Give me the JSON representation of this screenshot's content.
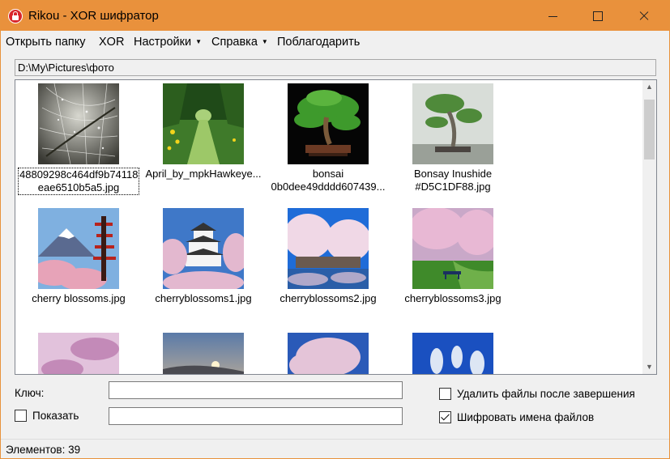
{
  "window": {
    "title": "Rikou - XOR шифратор",
    "accent": "#e9913c"
  },
  "menu": {
    "open_folder": "Открыть папку",
    "xor": "XOR",
    "settings": "Настройки",
    "help": "Справка",
    "thank": "Поблагодарить"
  },
  "path": "D:\\My\\Pictures\\фото",
  "files": [
    {
      "line1": "48809298c464df9b74118",
      "line2": "eae6510b5a5.jpg",
      "icon": "dewy-spiderweb-thumbnail"
    },
    {
      "line1": "April_by_mpkHawkeye...",
      "line2": "",
      "icon": "meadow-path-thumbnail"
    },
    {
      "line1": "bonsai",
      "line2": "0b0dee49dddd607439...",
      "icon": "bonsai-tree-thumbnail"
    },
    {
      "line1": "Bonsay Inushide",
      "line2": "#D5C1DF88.jpg",
      "icon": "bonsai-tree-thumbnail"
    },
    {
      "line1": "cherry blossoms.jpg",
      "line2": "",
      "icon": "pagoda-mount-fuji-thumbnail"
    },
    {
      "line1": "cherryblossoms1.jpg",
      "line2": "",
      "icon": "castle-blossoms-thumbnail"
    },
    {
      "line1": "cherryblossoms2.jpg",
      "line2": "",
      "icon": "blossom-river-thumbnail"
    },
    {
      "line1": "cherryblossoms3.jpg",
      "line2": "",
      "icon": "blossom-park-bench-thumbnail"
    }
  ],
  "key_label": "Ключ:",
  "key_value": "",
  "show_label": "Показать",
  "show_checked": false,
  "delete_label": "Удалить файлы после завершения",
  "delete_checked": false,
  "encrypt_names_label": "Шифровать имена файлов",
  "encrypt_names_checked": true,
  "status": "Элементов: 39"
}
